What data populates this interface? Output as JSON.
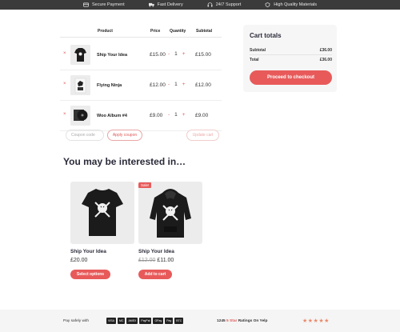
{
  "topbar": {
    "features": [
      {
        "icon": "credit-card-icon",
        "label": "Secure Payment"
      },
      {
        "icon": "truck-icon",
        "label": "Fast Delivery"
      },
      {
        "icon": "headphones-icon",
        "label": "24/7 Support"
      },
      {
        "icon": "shield-icon",
        "label": "High Quality Materials"
      }
    ]
  },
  "cart": {
    "headers": {
      "product": "Product",
      "price": "Price",
      "quantity": "Quantity",
      "subtotal": "Subtotal"
    },
    "remove_symbol": "×",
    "minus_symbol": "-",
    "plus_symbol": "+",
    "items": [
      {
        "name": "Ship Your Idea",
        "price": "£15.00",
        "qty": "1",
        "subtotal": "£15.00",
        "thumb_icon": "tshirt-icon"
      },
      {
        "name": "Flying Ninja",
        "price": "£12.00",
        "qty": "1",
        "subtotal": "£12.00",
        "thumb_icon": "poster-icon"
      },
      {
        "name": "Woo Album #4",
        "price": "£9.00",
        "qty": "1",
        "subtotal": "£9.00",
        "thumb_icon": "album-icon"
      }
    ],
    "coupon_placeholder": "Coupon code",
    "apply_label": "Apply coupon",
    "update_label": "Update cart"
  },
  "totals": {
    "title": "Cart totals",
    "subtotal_label": "Subtotal",
    "subtotal_value": "£36.00",
    "total_label": "Total",
    "total_value": "£36.00",
    "checkout_label": "Proceed to checkout"
  },
  "interested": {
    "title": "You may be interested in…",
    "products": [
      {
        "name": "Ship Your Idea",
        "price": "£20.00",
        "old_price": "",
        "button": "Select options",
        "sale": ""
      },
      {
        "name": "Ship Your Idea",
        "price": "£11.00",
        "old_price": "£12.00",
        "button": "Add to cart",
        "sale": "Sale!"
      }
    ]
  },
  "footer": {
    "pay_label": "Pay safely with",
    "payment_methods": [
      "VISA",
      "MC",
      "AMEX",
      "PayPal",
      "GPay",
      "Pay",
      "BTC"
    ],
    "rating_count": "1245",
    "rating_star_word": "5 Star",
    "rating_suffix": "Ratings On Yelp",
    "stars": "★★★★★"
  },
  "colors": {
    "accent": "#e85a5a",
    "topbar": "#3b3b3b",
    "card_bg": "#ececec"
  }
}
